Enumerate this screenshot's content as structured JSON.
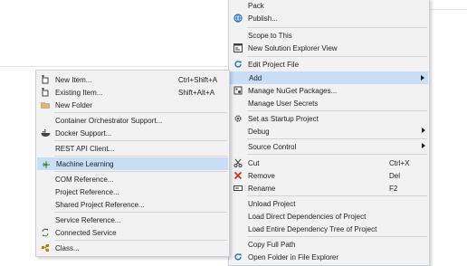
{
  "main_menu": {
    "pack": "Pack",
    "publish": "Publish...",
    "scope_to_this": "Scope to This",
    "new_solution_explorer_view": "New Solution Explorer View",
    "edit_project_file": "Edit Project File",
    "add": "Add",
    "manage_nuget": "Manage NuGet Packages...",
    "manage_user_secrets": "Manage User Secrets",
    "set_startup": "Set as Startup Project",
    "debug": "Debug",
    "source_control": "Source Control",
    "cut": "Cut",
    "cut_sc": "Ctrl+X",
    "remove": "Remove",
    "remove_sc": "Del",
    "rename": "Rename",
    "rename_sc": "F2",
    "unload": "Unload Project",
    "load_direct": "Load Direct Dependencies of Project",
    "load_tree": "Load Entire Dependency Tree of Project",
    "copy_full_path": "Copy Full Path",
    "open_folder": "Open Folder in File Explorer"
  },
  "sub_menu": {
    "new_item": "New Item...",
    "new_item_sc": "Ctrl+Shift+A",
    "existing_item": "Existing Item...",
    "existing_item_sc": "Shift+Alt+A",
    "new_folder": "New Folder",
    "container_orchestrator": "Container Orchestrator Support...",
    "docker_support": "Docker Support...",
    "rest_api_client": "REST API Client...",
    "machine_learning": "Machine Learning",
    "com_reference": "COM Reference...",
    "project_reference": "Project Reference...",
    "shared_project_reference": "Shared Project Reference...",
    "service_reference": "Service Reference...",
    "connected_service": "Connected Service",
    "class": "Class..."
  },
  "colors": {
    "menu_bg": "#f2f2f2",
    "hover": "#c9def5",
    "accent_blue": "#1c72c9",
    "remove_red": "#c42b1c"
  }
}
